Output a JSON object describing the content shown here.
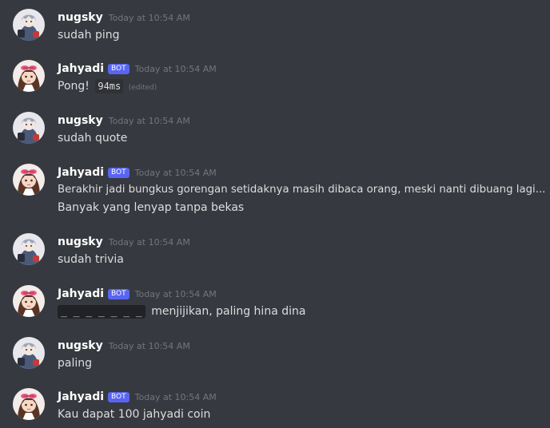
{
  "messages": [
    {
      "user": "nugsky",
      "time": "Today at 10:54 AM",
      "text": "sudah ping"
    },
    {
      "user": "Jahyadi",
      "badge": "BOT",
      "time": "Today at 10:54 AM",
      "text": "Pong!",
      "code": "94ms",
      "edited": "(edited)"
    },
    {
      "user": "nugsky",
      "time": "Today at 10:54 AM",
      "text": "sudah quote"
    },
    {
      "user": "Jahyadi",
      "badge": "BOT",
      "time": "Today at 10:54 AM",
      "line1": "Berakhir jadi bungkus gorengan setidaknya masih dibaca orang, meski nanti dibuang lagi...",
      "line2": "Banyak yang lenyap tanpa bekas"
    },
    {
      "user": "nugsky",
      "time": "Today at 10:54 AM",
      "text": "sudah trivia"
    },
    {
      "user": "Jahyadi",
      "badge": "BOT",
      "time": "Today at 10:54 AM",
      "blank": "_ _ _ _ _ _ _",
      "text": "menjijikan, paling hina dina"
    },
    {
      "user": "nugsky",
      "time": "Today at 10:54 AM",
      "text": "paling"
    },
    {
      "user": "Jahyadi",
      "badge": "BOT",
      "time": "Today at 10:54 AM",
      "text": "Kau dapat 100 jahyadi coin"
    }
  ]
}
